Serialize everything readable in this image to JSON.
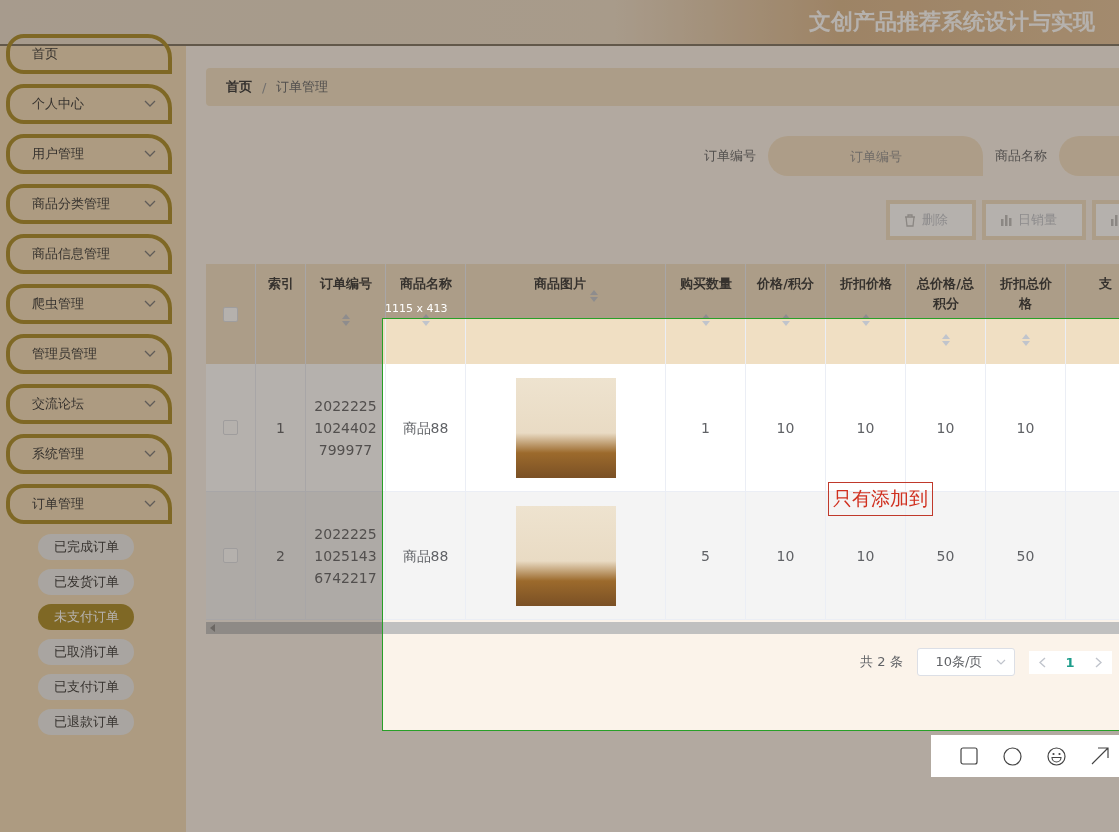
{
  "header": {
    "title": "文创产品推荐系统设计与实现"
  },
  "sidebar": {
    "items": [
      {
        "label": "首页",
        "kind": "link"
      },
      {
        "label": "个人中心",
        "kind": "menu"
      },
      {
        "label": "用户管理",
        "kind": "menu"
      },
      {
        "label": "商品分类管理",
        "kind": "menu"
      },
      {
        "label": "商品信息管理",
        "kind": "menu"
      },
      {
        "label": "爬虫管理",
        "kind": "menu"
      },
      {
        "label": "管理员管理",
        "kind": "menu"
      },
      {
        "label": "交流论坛",
        "kind": "menu"
      },
      {
        "label": "系统管理",
        "kind": "menu"
      },
      {
        "label": "订单管理",
        "kind": "menu",
        "children": [
          {
            "label": "已完成订单",
            "selected": false
          },
          {
            "label": "已发货订单",
            "selected": false
          },
          {
            "label": "未支付订单",
            "selected": true
          },
          {
            "label": "已取消订单",
            "selected": false
          },
          {
            "label": "已支付订单",
            "selected": false
          },
          {
            "label": "已退款订单",
            "selected": false
          }
        ]
      }
    ]
  },
  "breadcrumb": {
    "items": [
      "首页",
      "订单管理"
    ],
    "separator": "/"
  },
  "search": {
    "fields": [
      {
        "label": "订单编号",
        "placeholder": "订单编号"
      },
      {
        "label": "商品名称"
      }
    ]
  },
  "toolbar": {
    "buttons": [
      {
        "kind": "delete",
        "label": "删除"
      },
      {
        "kind": "chart",
        "label": "日销量"
      },
      {
        "kind": "chart"
      }
    ]
  },
  "table": {
    "select_all": {
      "checked": false
    },
    "columns": [
      {
        "label": "索引"
      },
      {
        "label": "订单编号",
        "sortable": true
      },
      {
        "label": "商品名称",
        "sortable": true
      },
      {
        "label": "商品图片",
        "sortable": true
      },
      {
        "label": "购买数量",
        "sortable": true
      },
      {
        "label": "价格/积分",
        "sortable": true
      },
      {
        "label": "折扣价格",
        "sortable": true
      },
      {
        "label": "总价格/总积分",
        "sortable": true
      },
      {
        "label": "折扣总价格",
        "sortable": true
      },
      {
        "label": "支"
      }
    ],
    "rows": [
      {
        "checked": false,
        "index": "1",
        "order_no": "20222251024402799977",
        "product": "商品88",
        "quantity": "1",
        "price": "10",
        "discount_price": "10",
        "total": "10",
        "discount_total": "10"
      },
      {
        "checked": false,
        "index": "2",
        "order_no": "202222510251436742217",
        "product": "商品88",
        "quantity": "5",
        "price": "10",
        "discount_price": "10",
        "total": "50",
        "discount_total": "50"
      }
    ]
  },
  "pagination": {
    "total": "共 2 条",
    "page_size": "10条/页",
    "pages": [
      {
        "label": "1",
        "selected": true
      }
    ]
  },
  "capture": {
    "size_label": "1115 x 413",
    "annotation": "只有添加到",
    "tools": [
      {
        "kind": "rectangle"
      },
      {
        "kind": "ellipse"
      },
      {
        "kind": "emoji"
      },
      {
        "kind": "arrow"
      }
    ]
  }
}
